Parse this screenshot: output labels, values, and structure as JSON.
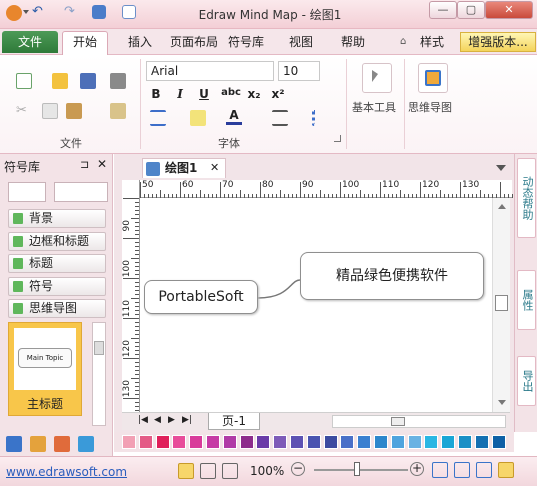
{
  "window": {
    "title": "Edraw Mind Map - 绘图1",
    "minimize": "—",
    "maximize": "▢",
    "close": "✕"
  },
  "tabs": {
    "file": "文件",
    "home": "开始",
    "insert": "插入",
    "page_layout": "页面布局",
    "symbols": "符号库",
    "view": "视图",
    "help": "帮助",
    "style": "样式",
    "upgrade": "增强版本..."
  },
  "ribbon": {
    "file_group": "文件",
    "font_group": "字体",
    "font_name": "Arial",
    "font_size": "10",
    "bold": "B",
    "italic": "I",
    "underline": "U",
    "strike": "abc",
    "subscript": "x₂",
    "superscript": "x²",
    "font_color_label": "A",
    "basic_tools": "基本工具",
    "mind_map": "思维导图"
  },
  "library": {
    "title": "符号库",
    "items": [
      "背景",
      "边框和标题",
      "标题",
      "符号",
      "思维导图"
    ],
    "thumbnail_topic": "Main Topic",
    "thumbnail_label": "主标题"
  },
  "document": {
    "tab": "绘图1",
    "nodes": {
      "left": "PortableSoft",
      "right": "精品绿色便携软件"
    },
    "ruler_top": [
      "50",
      "60",
      "70",
      "80",
      "90",
      "100",
      "110",
      "120",
      "130"
    ],
    "ruler_left": [
      "90",
      "100",
      "110",
      "120",
      "130"
    ],
    "page_tab": "页-1"
  },
  "right_panel": {
    "tabs": [
      "动态帮助",
      "属性",
      "导出"
    ]
  },
  "palette_colors": [
    "#f2a0b4",
    "#e45a86",
    "#e01e5a",
    "#e84c9a",
    "#d93a9a",
    "#c63aa5",
    "#b03aa6",
    "#8e2c8c",
    "#6b3aa8",
    "#7f5ab8",
    "#5e51b3",
    "#4b53b0",
    "#3d4aa0",
    "#4a6fc8",
    "#3b7fd0",
    "#2d86cc",
    "#4fa3de",
    "#6ab2e3",
    "#2bb6e3",
    "#1aa6d6",
    "#1b8fc6",
    "#156fb2",
    "#0f5fa6"
  ],
  "status": {
    "url": "www.edrawsoft.com",
    "zoom": "100%"
  }
}
